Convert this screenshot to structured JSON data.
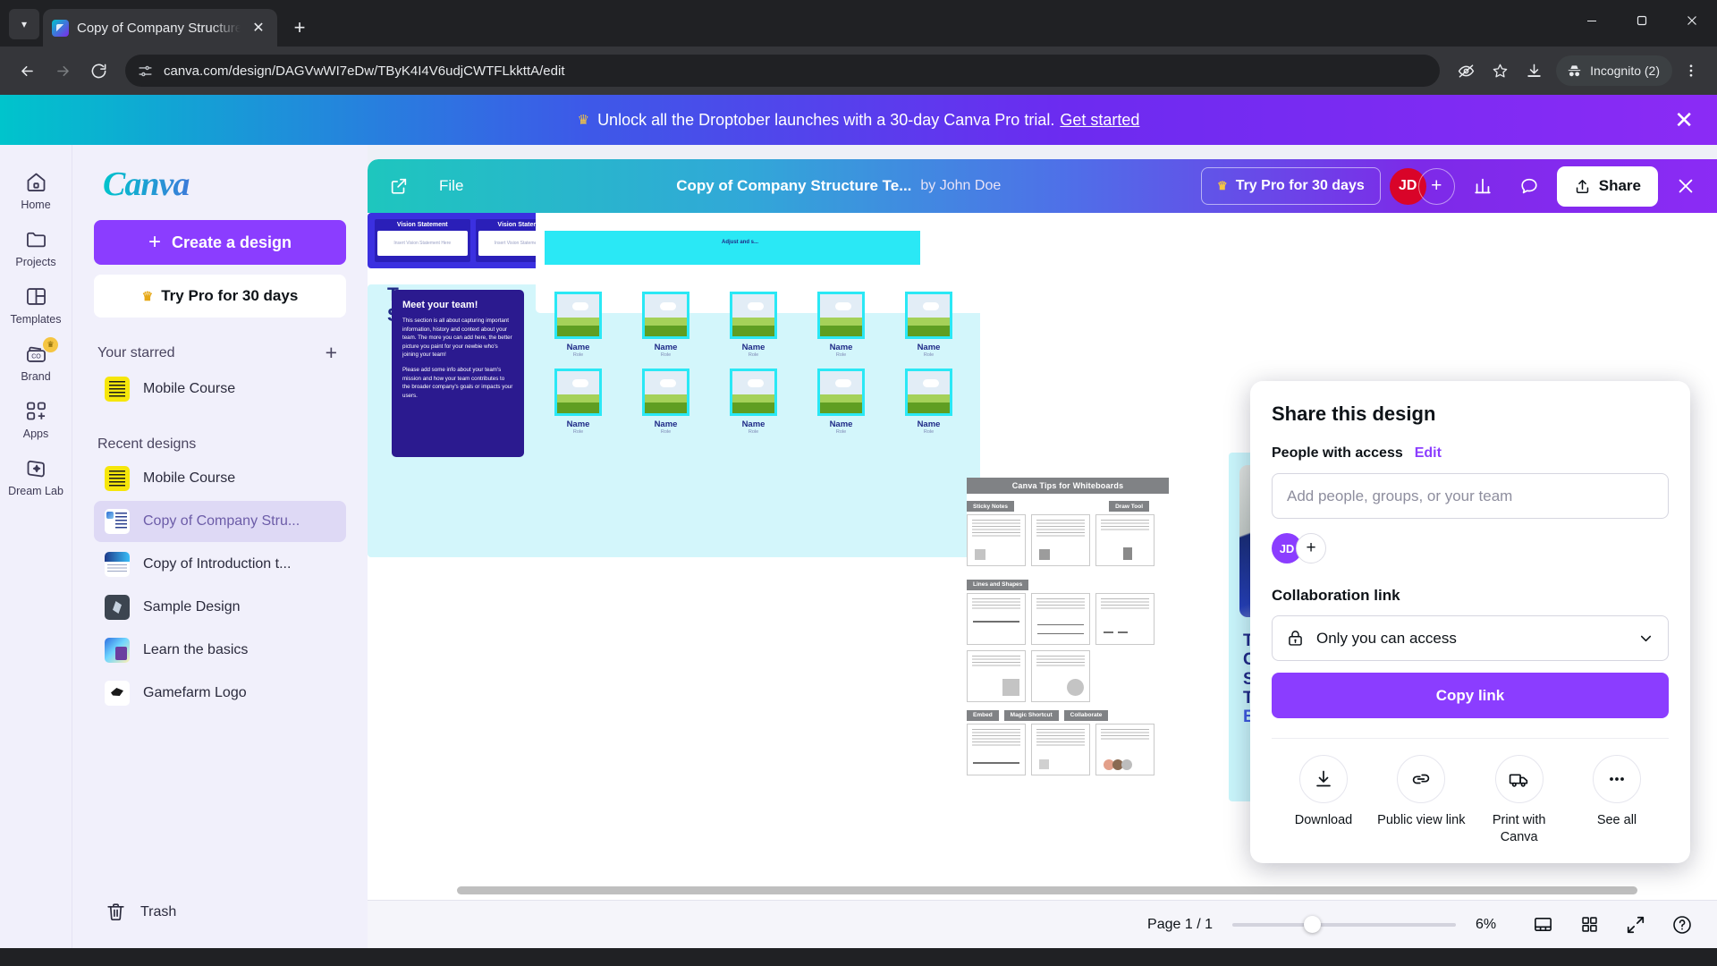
{
  "browser": {
    "tab_title": "Copy of Company Structure Tem",
    "url": "canva.com/design/DAGVwWI7eDw/TByK4I4V6udjCWTFLkkttA/edit",
    "incognito_label": "Incognito (2)"
  },
  "promo": {
    "text": "Unlock all the Droptober launches with a 30-day Canva Pro trial.",
    "link": "Get started"
  },
  "rail": {
    "items": [
      {
        "label": "Home",
        "icon": "home-icon"
      },
      {
        "label": "Projects",
        "icon": "folder-icon"
      },
      {
        "label": "Templates",
        "icon": "templates-icon"
      },
      {
        "label": "Brand",
        "icon": "brand-icon",
        "badge": "crown"
      },
      {
        "label": "Apps",
        "icon": "apps-icon"
      },
      {
        "label": "Dream Lab",
        "icon": "dream-lab-icon"
      }
    ]
  },
  "sidebar": {
    "logo": "Canva",
    "create_label": "Create a design",
    "try_pro_label": "Try Pro for 30 days",
    "starred_header": "Your starred",
    "starred": [
      {
        "name": "Mobile Course",
        "thumb": "th-mobile"
      }
    ],
    "recent_header": "Recent designs",
    "recent": [
      {
        "name": "Mobile Course",
        "thumb": "th-mobile",
        "active": false
      },
      {
        "name": "Copy of Company Stru...",
        "thumb": "th-company",
        "active": true
      },
      {
        "name": "Copy of Introduction t...",
        "thumb": "th-intro",
        "active": false
      },
      {
        "name": "Sample Design",
        "thumb": "th-sample",
        "active": false
      },
      {
        "name": "Learn the basics",
        "thumb": "th-learn",
        "active": false
      },
      {
        "name": "Gamefarm Logo",
        "thumb": "th-game",
        "active": false
      }
    ],
    "trash_label": "Trash"
  },
  "editor": {
    "file_menu": "File",
    "doc_title": "Copy of Company Structure Te...",
    "author": "by John Doe",
    "try_pro_label": "Try Pro for 30 days",
    "avatar_initials": "JD",
    "share_label": "Share"
  },
  "status": {
    "page_label": "Page 1 / 1",
    "zoom": "6%"
  },
  "share_panel": {
    "title": "Share this design",
    "people_label": "People with access",
    "edit_label": "Edit",
    "input_placeholder": "Add people, groups, or your team",
    "input_value": "",
    "avatar_initials": "JD",
    "collab_label": "Collaboration link",
    "access_value": "Only you can access",
    "copy_label": "Copy link",
    "actions": [
      {
        "label": "Download",
        "icon": "download-icon"
      },
      {
        "label": "Public view link",
        "icon": "link-icon"
      },
      {
        "label": "Print with Canva",
        "icon": "truck-icon"
      },
      {
        "label": "See all",
        "icon": "ellipsis-icon"
      }
    ]
  },
  "canvas": {
    "tips_banner": "Canva Tips for Whiteboards",
    "tips_tags": [
      "Sticky Notes",
      "Draw Tool",
      "Lines and Shapes",
      "Embed",
      "Magic Shortcut",
      "Collaborate"
    ],
    "example_card": {
      "line1": "The",
      "line2": "Company",
      "line3": "Structure",
      "line4": "Template",
      "line5": "Example"
    },
    "structure_card": {
      "line1": "The Company",
      "line2": "Structure ",
      "accent": "Templa"
    },
    "org_nodes": [
      {
        "name": "Name",
        "role": "Role"
      },
      {
        "name": "Name",
        "role": "Role"
      },
      {
        "name": "Name",
        "role": "Role"
      },
      {
        "name": "Name",
        "role": "Role"
      },
      {
        "name": "Name",
        "role": "Role"
      },
      {
        "name": "Name",
        "role": "Role"
      }
    ],
    "vision_title": "Vision Statement",
    "vision_body": "Insert Vision Statement Here",
    "team_title_1": "Team",
    "team_title_2": "Structure",
    "team_note_heading": "Meet your team!",
    "team_note_p1": "This section is all about capturing important information, history and context about your team. The more you can add here, the better picture you paint for your newbie who's joining your team!",
    "team_note_p2": "Please add some info about your team's mission and how your team contributes to the broader company's goals or impacts your users.",
    "adjust_note": "Adjust and s...",
    "member_name": "Name",
    "member_role": "Role"
  },
  "colors": {
    "brand_purple": "#8b3dff",
    "brand_teal": "#00c4cc",
    "accent_red": "#d90429",
    "canvas_cyan": "#2ae8f5",
    "navy": "#1f2a87"
  }
}
